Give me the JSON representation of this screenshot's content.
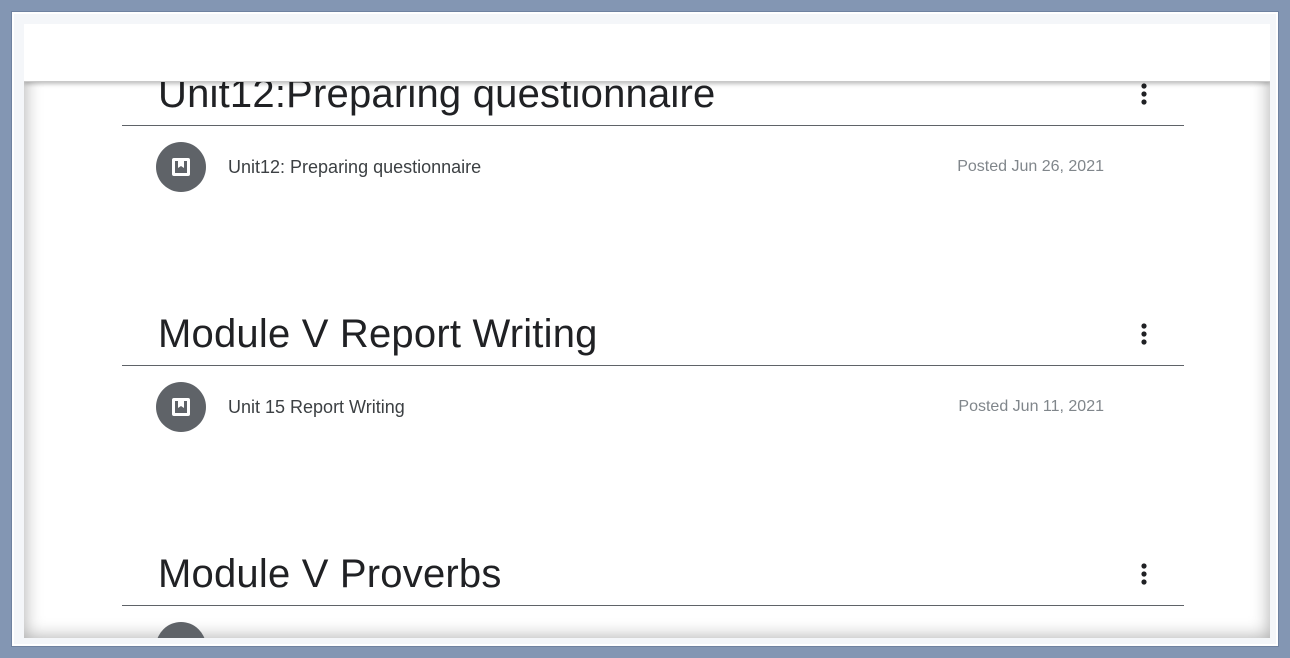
{
  "topics": [
    {
      "title": "Unit12:Preparing questionnaire",
      "items": [
        {
          "icon": "material-icon",
          "title": "Unit12: Preparing questionnaire",
          "posted": "Posted Jun 26, 2021"
        }
      ]
    },
    {
      "title": "Module V Report Writing",
      "items": [
        {
          "icon": "material-icon",
          "title": "Unit 15 Report Writing",
          "posted": "Posted Jun 11, 2021"
        }
      ]
    },
    {
      "title": "Module V Proverbs",
      "items": []
    }
  ],
  "icons": {
    "more": "more-vert-icon",
    "material": "material-icon"
  },
  "colors": {
    "frame": "#8396b3",
    "icon_bg": "#5f6368",
    "title": "#202124",
    "date": "#80868b"
  }
}
